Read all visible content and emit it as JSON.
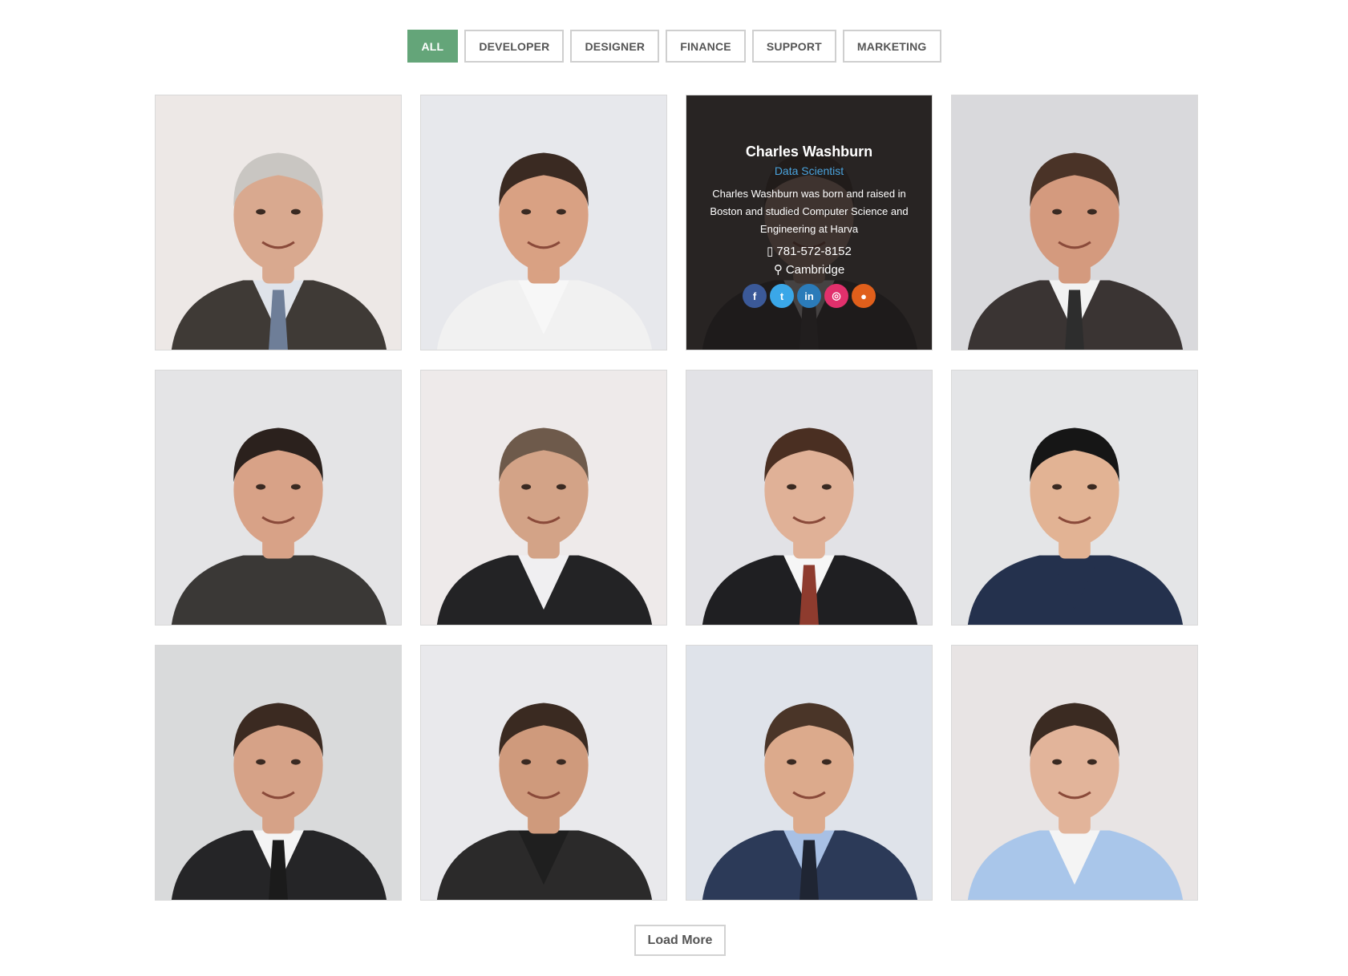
{
  "filters": [
    {
      "label": "ALL",
      "active": true
    },
    {
      "label": "DEVELOPER",
      "active": false
    },
    {
      "label": "DESIGNER",
      "active": false
    },
    {
      "label": "FINANCE",
      "active": false
    },
    {
      "label": "SUPPORT",
      "active": false
    },
    {
      "label": "MARKETING",
      "active": false
    }
  ],
  "members": [
    {
      "photo": "portrait-photo",
      "bg": "#ede8e6",
      "skin": "#d9a98f",
      "hair": "#c9c6c2",
      "suit": "#3f3a36",
      "shirt": "#dfe3ea",
      "tie": "#6e7e98"
    },
    {
      "photo": "portrait-photo",
      "bg": "#e7e8ec",
      "skin": "#d9a183",
      "hair": "#3a2a22",
      "suit": "#f1f1f1",
      "shirt": "#f7f7f7",
      "tie": ""
    },
    {
      "photo": "portrait-photo",
      "bg": "#5b5552",
      "skin": "#c8a08a",
      "hair": "#3a2d27",
      "suit": "#2a2a2c",
      "shirt": "#e9e9e9",
      "tie": "#3a3a3a",
      "overlay": {
        "name": "Charles Washburn",
        "role": "Data Scientist",
        "bio": "Charles Washburn was born and raised in Boston and studied Computer Science and Engineering at Harva",
        "phone": "781-572-8152",
        "location": "Cambridge",
        "socials": [
          {
            "icon": "facebook-icon",
            "glyph": "f",
            "color": "#3b5998"
          },
          {
            "icon": "twitter-icon",
            "glyph": "t",
            "color": "#3aa7e8"
          },
          {
            "icon": "linkedin-icon",
            "glyph": "in",
            "color": "#2b7bb9"
          },
          {
            "icon": "instagram-icon",
            "glyph": "◎",
            "color": "#e1306c"
          },
          {
            "icon": "github-icon",
            "glyph": "●",
            "color": "#e05f1b"
          }
        ]
      }
    },
    {
      "photo": "portrait-photo",
      "bg": "#d9d9dc",
      "skin": "#d49a7e",
      "hair": "#4a3327",
      "suit": "#3a3433",
      "shirt": "#f2f2f2",
      "tie": "#2d2d2d"
    },
    {
      "photo": "portrait-photo",
      "bg": "#e4e4e6",
      "skin": "#d8a287",
      "hair": "#2b211d",
      "suit": "#3a3836",
      "shirt": "#3a3836",
      "tie": ""
    },
    {
      "photo": "portrait-photo",
      "bg": "#eeeaea",
      "skin": "#d3a387",
      "hair": "#6e5a4b",
      "suit": "#232325",
      "shirt": "#f0eff1",
      "tie": ""
    },
    {
      "photo": "portrait-photo",
      "bg": "#e2e2e6",
      "skin": "#e0b197",
      "hair": "#4a2f22",
      "suit": "#1f1f22",
      "shirt": "#f6f6f6",
      "tie": "#8e3b2e"
    },
    {
      "photo": "portrait-photo",
      "bg": "#e4e5e7",
      "skin": "#e2b394",
      "hair": "#161616",
      "suit": "#24314d",
      "shirt": "#24314d",
      "tie": ""
    },
    {
      "photo": "portrait-photo",
      "bg": "#d9dadb",
      "skin": "#d6a287",
      "hair": "#3b2a21",
      "suit": "#252527",
      "shirt": "#f4f4f4",
      "tie": "#1b1b1b"
    },
    {
      "photo": "portrait-photo",
      "bg": "#e9e9ec",
      "skin": "#cf9a7c",
      "hair": "#3a2a21",
      "suit": "#2b2a2a",
      "shirt": "#1f1f1f",
      "tie": ""
    },
    {
      "photo": "portrait-photo",
      "bg": "#dfe3ea",
      "skin": "#dcaa8c",
      "hair": "#4a3528",
      "suit": "#2c3a58",
      "shirt": "#a8c0e4",
      "tie": "#1f2533"
    },
    {
      "photo": "portrait-photo",
      "bg": "#e8e4e4",
      "skin": "#e2b49a",
      "hair": "#3b2b22",
      "suit": "#a9c6ea",
      "shirt": "#f4f4f4",
      "tie": ""
    }
  ],
  "load_more": "Load More"
}
